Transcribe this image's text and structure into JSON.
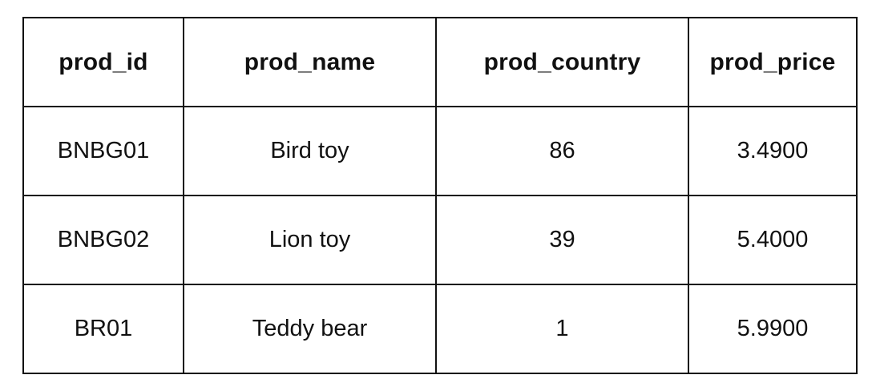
{
  "table": {
    "headers": [
      "prod_id",
      "prod_name",
      "prod_country",
      "prod_price"
    ],
    "rows": [
      [
        "BNBG01",
        "Bird toy",
        "86",
        "3.4900"
      ],
      [
        "BNBG02",
        "Lion toy",
        "39",
        "5.4000"
      ],
      [
        "BR01",
        "Teddy bear",
        "1",
        "5.9900"
      ]
    ]
  }
}
